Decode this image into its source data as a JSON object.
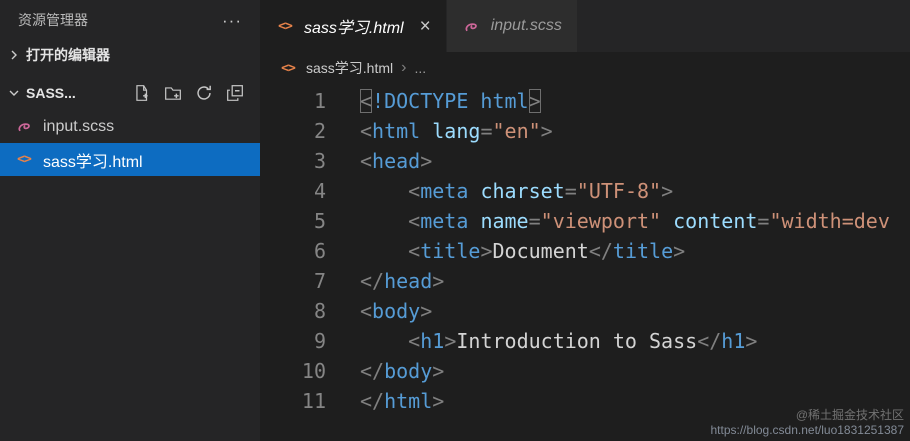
{
  "sidebar": {
    "title": "资源管理器",
    "more_glyph": "···",
    "open_editors_label": "打开的编辑器",
    "workspace_label": "SASS...",
    "files": [
      {
        "name": "input.scss",
        "icon": "sass-icon",
        "selected": false
      },
      {
        "name": "sass学习.html",
        "icon": "html-icon",
        "selected": true
      }
    ]
  },
  "icons": {
    "html_glyph": "<>",
    "close_glyph": "×"
  },
  "tabs": [
    {
      "label": "sass学习.html",
      "active": true
    },
    {
      "label": "input.scss",
      "active": false
    }
  ],
  "breadcrumb": {
    "file": "sass学习.html",
    "separator_glyph": "›",
    "more": "..."
  },
  "editor": {
    "language": "html",
    "lines": [
      {
        "n": 1,
        "tokens": [
          {
            "t": "<",
            "y": "punct",
            "m": true
          },
          {
            "t": "!DOCTYPE",
            "y": "tag"
          },
          {
            "t": " html",
            "y": "tag"
          },
          {
            "t": ">",
            "y": "punct",
            "m": true
          }
        ]
      },
      {
        "n": 2,
        "tokens": [
          {
            "t": "<",
            "y": "punct"
          },
          {
            "t": "html",
            "y": "tag"
          },
          {
            "t": " ",
            "y": "txt"
          },
          {
            "t": "lang",
            "y": "attr"
          },
          {
            "t": "=",
            "y": "punct"
          },
          {
            "t": "\"en\"",
            "y": "str"
          },
          {
            "t": ">",
            "y": "punct"
          }
        ]
      },
      {
        "n": 3,
        "tokens": [
          {
            "t": "<",
            "y": "punct"
          },
          {
            "t": "head",
            "y": "tag"
          },
          {
            "t": ">",
            "y": "punct"
          }
        ]
      },
      {
        "n": 4,
        "tokens": [
          {
            "t": "    ",
            "y": "txt"
          },
          {
            "t": "<",
            "y": "punct"
          },
          {
            "t": "meta",
            "y": "tag"
          },
          {
            "t": " ",
            "y": "txt"
          },
          {
            "t": "charset",
            "y": "attr"
          },
          {
            "t": "=",
            "y": "punct"
          },
          {
            "t": "\"UTF-8\"",
            "y": "str"
          },
          {
            "t": ">",
            "y": "punct"
          }
        ]
      },
      {
        "n": 5,
        "tokens": [
          {
            "t": "    ",
            "y": "txt"
          },
          {
            "t": "<",
            "y": "punct"
          },
          {
            "t": "meta",
            "y": "tag"
          },
          {
            "t": " ",
            "y": "txt"
          },
          {
            "t": "name",
            "y": "attr"
          },
          {
            "t": "=",
            "y": "punct"
          },
          {
            "t": "\"viewport\"",
            "y": "str"
          },
          {
            "t": " ",
            "y": "txt"
          },
          {
            "t": "content",
            "y": "attr"
          },
          {
            "t": "=",
            "y": "punct"
          },
          {
            "t": "\"width=dev",
            "y": "str"
          }
        ]
      },
      {
        "n": 6,
        "tokens": [
          {
            "t": "    ",
            "y": "txt"
          },
          {
            "t": "<",
            "y": "punct"
          },
          {
            "t": "title",
            "y": "tag"
          },
          {
            "t": ">",
            "y": "punct"
          },
          {
            "t": "Document",
            "y": "txt"
          },
          {
            "t": "</",
            "y": "punct"
          },
          {
            "t": "title",
            "y": "tag"
          },
          {
            "t": ">",
            "y": "punct"
          }
        ]
      },
      {
        "n": 7,
        "tokens": [
          {
            "t": "</",
            "y": "punct"
          },
          {
            "t": "head",
            "y": "tag"
          },
          {
            "t": ">",
            "y": "punct"
          }
        ]
      },
      {
        "n": 8,
        "tokens": [
          {
            "t": "<",
            "y": "punct"
          },
          {
            "t": "body",
            "y": "tag"
          },
          {
            "t": ">",
            "y": "punct"
          }
        ]
      },
      {
        "n": 9,
        "tokens": [
          {
            "t": "    ",
            "y": "txt"
          },
          {
            "t": "<",
            "y": "punct"
          },
          {
            "t": "h1",
            "y": "tag"
          },
          {
            "t": ">",
            "y": "punct"
          },
          {
            "t": "Introduction to Sass",
            "y": "txt"
          },
          {
            "t": "</",
            "y": "punct"
          },
          {
            "t": "h1",
            "y": "tag"
          },
          {
            "t": ">",
            "y": "punct"
          }
        ]
      },
      {
        "n": 10,
        "tokens": [
          {
            "t": "</",
            "y": "punct"
          },
          {
            "t": "body",
            "y": "tag"
          },
          {
            "t": ">",
            "y": "punct"
          }
        ]
      },
      {
        "n": 11,
        "tokens": [
          {
            "t": "</",
            "y": "punct"
          },
          {
            "t": "html",
            "y": "tag"
          },
          {
            "t": ">",
            "y": "punct"
          }
        ]
      }
    ]
  },
  "colors": {
    "editor_bg": "#1e1e1e",
    "sidebar_bg": "#252526",
    "inactive_tab_bg": "#2d2d2d",
    "selection_bg": "#0d6cc1",
    "tag": "#569cd6",
    "attr": "#9cdcfe",
    "string": "#ce9178",
    "punct": "#808080",
    "plain_text": "#d4d4d4",
    "line_number": "#858585",
    "sass_pink": "#cd6799",
    "html_orange": "#e8834a"
  },
  "watermark": {
    "community": "@稀土掘金技术社区",
    "url": "https://blog.csdn.net/luo1831251387"
  }
}
